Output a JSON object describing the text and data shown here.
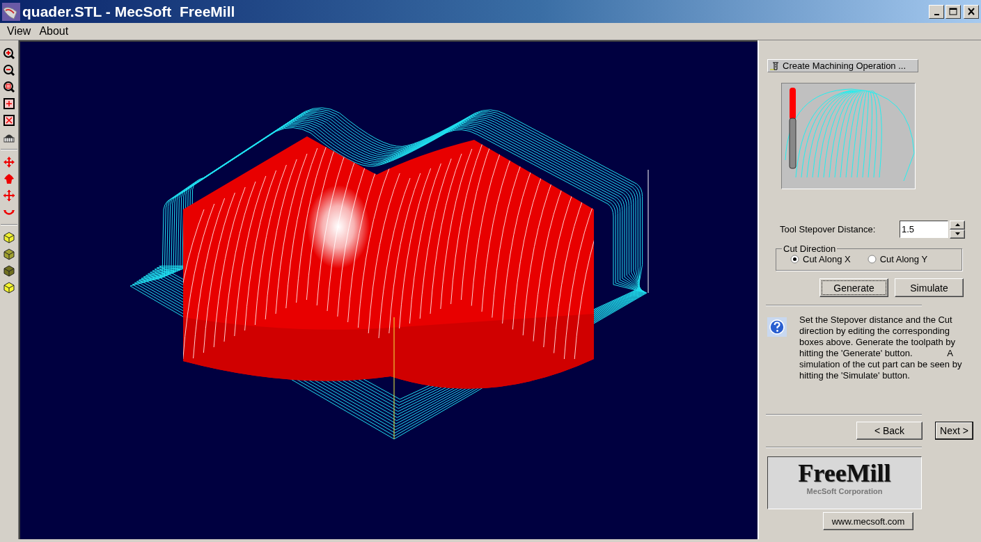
{
  "window": {
    "title": "quader.STL - MecSoft  FreeMill"
  },
  "menu": [
    {
      "label": "View"
    },
    {
      "label": "About"
    }
  ],
  "panel": {
    "operation_button": "Create Machining Operation ...",
    "stepover": {
      "label": "Tool Stepover Distance:",
      "value": "1.5"
    },
    "cut_direction": {
      "title": "Cut Direction",
      "options": [
        {
          "label": "Cut Along X",
          "selected": true
        },
        {
          "label": "Cut Along Y",
          "selected": false
        }
      ]
    },
    "actions": [
      {
        "label": "Generate",
        "focused": true
      },
      {
        "label": "Simulate",
        "focused": false
      }
    ],
    "help_text": "Set the Stepover distance and the Cut direction by editing the corresponding boxes above. Generate the toolpath by hitting the 'Generate' button.              A simulation of the cut part can be seen by hitting the 'Simulate' button.",
    "navigation": [
      {
        "label": "< Back",
        "default": false
      },
      {
        "label": "Next >",
        "default": true
      }
    ],
    "logo": {
      "name": "FreeMill",
      "company": "MecSoft Corporation"
    },
    "link": "www.mecsoft.com"
  }
}
